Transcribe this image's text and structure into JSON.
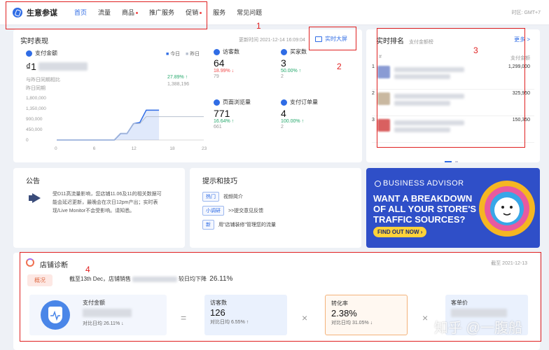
{
  "nav": {
    "brand": "生意参谋",
    "items": [
      {
        "label": "首页",
        "active": true,
        "dot": false
      },
      {
        "label": "流量",
        "active": false,
        "dot": false
      },
      {
        "label": "商品",
        "active": false,
        "dot": true
      },
      {
        "label": "推广服务",
        "active": false,
        "dot": false
      },
      {
        "label": "促销",
        "active": false,
        "dot": true
      },
      {
        "label": "服务",
        "active": false,
        "dot": false
      },
      {
        "label": "常见问题",
        "active": false,
        "dot": false
      }
    ],
    "timezone": "时区: GMT+7"
  },
  "annotations": [
    "1",
    "2",
    "3",
    "4"
  ],
  "realtime": {
    "title": "实时表现",
    "updated": "更新时间 2021-12-14 16:09:04",
    "bigscreen": "实时大屏",
    "pay_amount_label": "支付金额",
    "legend_today": "今日",
    "legend_yesterday": "昨日",
    "pay_amount_prefix": "₫1",
    "compare_line1": "与昨日同期相比",
    "compare_line2": "昨日同期",
    "compare_pct": "27.89% ↑",
    "compare_val": "1,388,196",
    "metrics": [
      {
        "label": "访客数",
        "value": "64",
        "change": "18.99% ↓",
        "dir": "down",
        "prev": "79"
      },
      {
        "label": "买家数",
        "value": "3",
        "change": "50.00% ↑",
        "dir": "up",
        "prev": "2"
      },
      {
        "label": "页面浏览量",
        "value": "771",
        "change": "16.64% ↑",
        "dir": "up",
        "prev": "661"
      },
      {
        "label": "支付订单量",
        "value": "4",
        "change": "100.00% ↑",
        "dir": "up",
        "prev": "2"
      }
    ]
  },
  "chart_data": {
    "type": "line",
    "y_ticks": [
      "1,800,000",
      "1,350,000",
      "900,000",
      "450,000",
      "0"
    ],
    "x_ticks": [
      "0",
      "6",
      "12",
      "18",
      "23"
    ],
    "ylim": [
      0,
      1800000
    ],
    "series": [
      {
        "name": "今日",
        "color": "#2f6ce5",
        "x": [
          0,
          1,
          2,
          3,
          4,
          5,
          6,
          7,
          8,
          9,
          10,
          11,
          12,
          13,
          14,
          15,
          16
        ],
        "y": [
          0,
          0,
          0,
          0,
          0,
          0,
          0,
          0,
          0,
          0,
          280000,
          280000,
          700000,
          750000,
          1280000,
          1280000,
          1280000
        ]
      },
      {
        "name": "昨日",
        "color": "#b7c0cf",
        "x": [
          0,
          1,
          2,
          3,
          4,
          5,
          6,
          7,
          8,
          9,
          10,
          11,
          12,
          13,
          14,
          15,
          16,
          17,
          18,
          19,
          20,
          21,
          22,
          23
        ],
        "y": [
          0,
          0,
          0,
          0,
          0,
          0,
          0,
          0,
          0,
          0,
          280000,
          280000,
          700000,
          700000,
          1000000,
          1000000,
          1000000,
          1000000,
          1000000,
          1000000,
          1000000,
          1000000,
          1000000,
          1000000
        ]
      }
    ]
  },
  "ranking": {
    "title": "实时排名",
    "subtitle": "支付金额榜",
    "more": "更多 >",
    "col_index": "#",
    "col_amount": "支付金额",
    "rows": [
      {
        "rank": "1",
        "name": "...Cho Yamaha",
        "amount": "1,299,000",
        "color": "#8a9bd4"
      },
      {
        "rank": "2",
        "name": "",
        "amount": "325,950",
        "color": "#c9b8a0"
      },
      {
        "rank": "3",
        "name": "",
        "amount": "150,350",
        "color": "#d96060"
      }
    ]
  },
  "notice": {
    "title": "公告",
    "body": "受D11高流量影响，您店铺11.06及11的相关数据可能会延迟更新，最晚会在次日12pm产出；实时表现/Live Monitor不会受影响。请知悉。"
  },
  "tips": {
    "title": "提示和技巧",
    "items": [
      {
        "tag": "热门",
        "text": "视频简介"
      },
      {
        "tag": "小调研",
        "text": ">>提交意见反馈"
      },
      {
        "tag": "新",
        "text": "用\"店铺装修\"管理您的流量"
      }
    ]
  },
  "banner": {
    "brand": "BUSINESS ADVISOR",
    "headline": "WANT A BREAKDOWN OF ALL YOUR STORE'S TRAFFIC SOURCES?",
    "button": "FIND OUT NOW ›"
  },
  "diagnosis": {
    "title": "店铺诊断",
    "date": "截至 2021-12-13",
    "tag": "概况",
    "summary_prefix": "截至13th Dec，店铺销售",
    "summary_suffix": "较日均下降",
    "summary_pct": "26.11%",
    "pay": {
      "label": "支付金额",
      "compare": "对比日均 26.11% ↓"
    },
    "visitors": {
      "label": "访客数",
      "value": "126",
      "compare": "对比日均 6.55% ↑"
    },
    "conversion": {
      "label": "转化率",
      "value": "2.38%",
      "compare": "对比日均 31.05% ↓"
    },
    "aov": {
      "label": "客单价"
    },
    "eq": "=",
    "times1": "×",
    "times2": "×"
  },
  "watermark": "知乎 @一腹船"
}
